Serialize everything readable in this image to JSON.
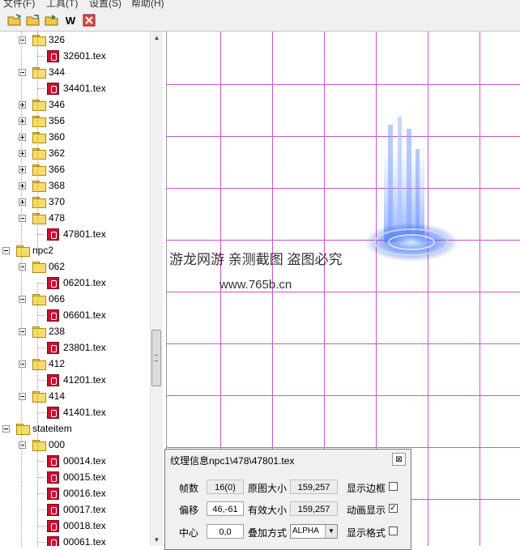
{
  "menu": [
    "文件(F)",
    "工具(T)",
    "设置(S)",
    "帮助(H)"
  ],
  "toolbar": [
    "open-folder-icon",
    "open-file-icon",
    "export-icon",
    "w-icon",
    "settings-icon"
  ],
  "toolbar_w_label": "W",
  "tree": [
    "326",
    "32601.tex",
    "344",
    "34401.tex",
    "346",
    "356",
    "360",
    "362",
    "366",
    "368",
    "370",
    "478",
    "47801.tex",
    "npc2",
    "062",
    "06201.tex",
    "066",
    "06601.tex",
    "238",
    "23801.tex",
    "412",
    "41201.tex",
    "414",
    "41401.tex",
    "stateitem",
    "000",
    "00014.tex",
    "00015.tex",
    "00016.tex",
    "00017.tex",
    "00018.tex",
    "00061.tex"
  ],
  "watermark": {
    "line1": "游龙网游 亲测截图 盗图必究",
    "line2": "www.765b.cn"
  },
  "panel": {
    "title": "纹理信息npc1\\478\\47801.tex",
    "close": "⊠",
    "frames_label": "帧数",
    "frames_value": "16(0)",
    "orig_size_label": "原图大小",
    "orig_size_value": "159,257",
    "show_border_label": "显示边框",
    "show_border_checked": "",
    "offset_label": "偏移",
    "offset_value": "46,-61",
    "valid_size_label": "有效大小",
    "valid_size_value": "159,257",
    "anim_label": "动画显示",
    "anim_checked": "✓",
    "center_label": "中心",
    "center_value": "0,0",
    "blend_label": "叠加方式",
    "blend_value": "ALPHA",
    "show_format_label": "显示格式",
    "show_format_checked": ""
  },
  "colors": {
    "grid": "#cc55cc",
    "tex_icon": "#c8102e",
    "folder": "#f7dc6a"
  }
}
